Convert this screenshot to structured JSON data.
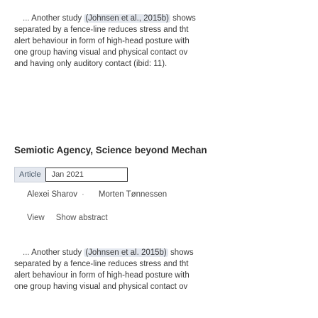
{
  "snippet_top": {
    "ellipsis": "...",
    "lead": "Another study",
    "citation": "(Johnsen et al., 2015b)",
    "after": "shows",
    "lines": [
      "separated by a fence-line reduces stress and tht",
      "alert behaviour in form of high-head posture with",
      "one group having visual and physical contact ov",
      "and having only auditory contact (ibid: 11)."
    ]
  },
  "result": {
    "title": "Semiotic Agency, Science beyond Mechan",
    "type_tag": "Article",
    "date": "Jan 2021",
    "authors": [
      "Alexei Sharov",
      "Morten Tønnessen"
    ],
    "actions": {
      "view": "View",
      "show_abstract": "Show abstract"
    }
  },
  "snippet_bottom": {
    "ellipsis": "...",
    "lead": "Another study",
    "citation": "(Johnsen et al. 2015b)",
    "after": "shows",
    "lines": [
      "separated by a fence-line reduces stress and tht",
      "alert behaviour in form of high-head posture with",
      "one group having visual and physical contact ov"
    ]
  },
  "colors": {
    "highlight": "#e4e8ef",
    "text": "#3a3a3a",
    "title": "#2b2b2b"
  }
}
